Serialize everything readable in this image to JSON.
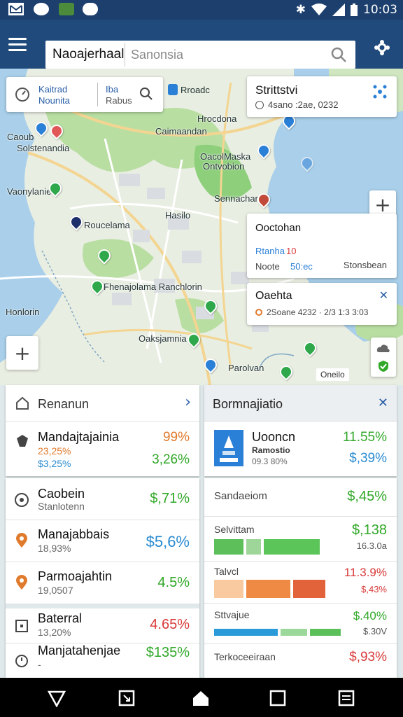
{
  "status_bar": {
    "time": "10:03",
    "icons": [
      "mail-icon",
      "messenger-icon",
      "photo-icon",
      "chat-icon",
      "bluetooth-icon",
      "wifi-icon",
      "signal-icon",
      "battery-icon"
    ]
  },
  "search": {
    "query": "Naoajerhaal",
    "placeholder": "Sanonsia"
  },
  "map": {
    "labels": [
      "Caoub",
      "Solstenandia",
      "Vaonylanie",
      "Roucelama",
      "Fhenajolama Ranchlorin",
      "Honlorin",
      "Oaksjamnia",
      "Parolvan",
      "Hrocdona",
      "Caimaandan",
      "OacolMaska",
      "Ontvobion",
      "Sennacham",
      "Hasilo",
      "Onejo"
    ],
    "controls": {
      "top_left_card": {
        "line1": "Kaitrad",
        "line2": "Nounita",
        "right1": "Iba",
        "right2": "Rabus"
      },
      "route_chip": "Rroadc",
      "stats_card": {
        "title": "Strittstvi",
        "detail": "4sano :2ae, 0232"
      },
      "info_card": {
        "title": "Ooctohan",
        "tag": "Rtanha",
        "tag_count": "10",
        "left": "Noote",
        "mid": "50:ec",
        "right": "Stonsbean"
      },
      "alert_card": {
        "title": "Oaehta",
        "detail": "2Soane 4232 · 2/3 1:3 3:03"
      },
      "zoom_in_label": "+",
      "add_label": "+",
      "scale_chip": "Oneilo"
    }
  },
  "left_panel": {
    "header": "Renanun",
    "featured": {
      "name": "Mandajtajainia",
      "sub_orange": "23,25%",
      "sub_blue": "$3,25%",
      "value_top": "99%",
      "value_bottom": "3,26%"
    },
    "rows": [
      {
        "name": "Caobein",
        "sub": "Stanlotenn",
        "value": "$,71%",
        "color": "green",
        "icon": "target-icon"
      },
      {
        "name": "Manajabbais",
        "sub": "18,93%",
        "value": "$5,6%",
        "color": "blue",
        "icon": "location-pin-icon"
      },
      {
        "name": "Parmoajahtin",
        "sub": "19,0507",
        "value": "4.5%",
        "color": "green",
        "icon": "location-pin-icon"
      },
      {
        "name": "Baterral",
        "sub": "13,20%",
        "value": "4.65%",
        "color": "red",
        "icon": "square-icon"
      },
      {
        "name": "Manjatahenjae",
        "sub": "-",
        "value": "$135%",
        "color": "green",
        "icon": "clock-icon"
      }
    ]
  },
  "right_panel": {
    "header": "Bormnajiatio",
    "featured": {
      "title": "Uooncn",
      "sub1": "Ramostio",
      "sub2": "09.3 80%",
      "value_top": "11.55%",
      "value_bottom": "$,39%"
    },
    "rows": [
      {
        "label": "Sandaeiom",
        "value": "$,45%",
        "value_color": "green",
        "bars": []
      },
      {
        "label": "Selvittam",
        "value": "$,138",
        "sub": "16.3.0a",
        "value_color": "green",
        "bars": [
          {
            "color": "#5cbf5a",
            "fraction": 0.22
          },
          {
            "color": "#9ed69a",
            "fraction": 0.11
          },
          {
            "color": "#5cc55a",
            "fraction": 0.42
          }
        ]
      },
      {
        "label": "Talvcl",
        "value": "11.3.9%",
        "sub": "$,43%",
        "value_color": "red",
        "bars": [
          {
            "color": "#f9c9a0",
            "fraction": 0.22
          },
          {
            "color": "#ef8a44",
            "fraction": 0.33
          },
          {
            "color": "#e2633a",
            "fraction": 0.24
          }
        ]
      },
      {
        "label": "Sttvajue",
        "value": "$.40%",
        "sub": "$.30V",
        "value_color": "green",
        "bars": [
          {
            "color": "#2a9ad8",
            "fraction": 0.48
          },
          {
            "color": "#9cd89a",
            "fraction": 0.2
          },
          {
            "color": "#5cbf5a",
            "fraction": 0.23
          }
        ]
      },
      {
        "label": "Terkoceeiraan",
        "value": "$,93%",
        "value_color": "red",
        "bars": []
      }
    ]
  },
  "colors": {
    "status_bar": "#1c3f6e",
    "app_bar": "#204a7c",
    "positive": "#31a829",
    "info": "#2a8bd1",
    "negative": "#d83a3a"
  }
}
